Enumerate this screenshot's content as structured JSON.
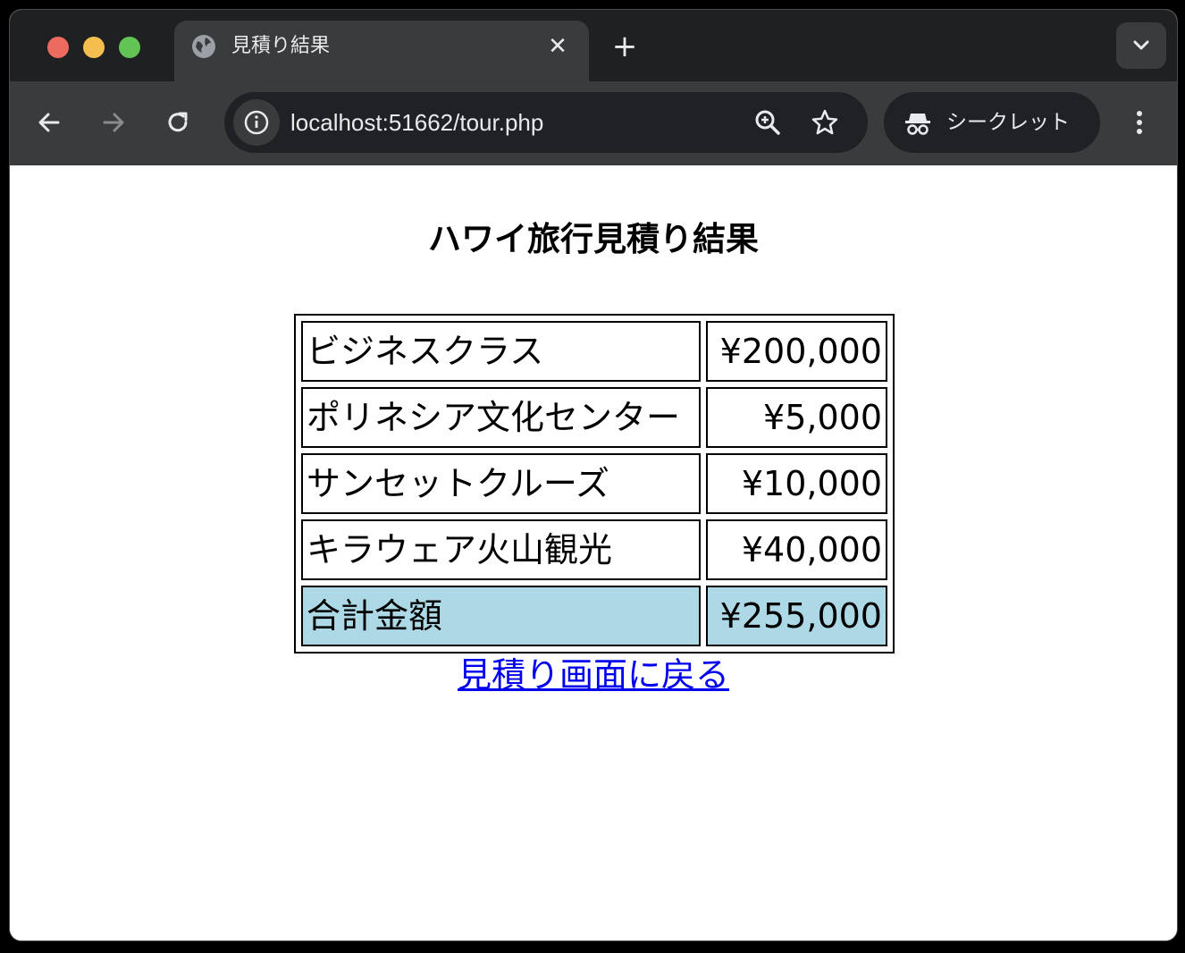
{
  "browser": {
    "tab": {
      "title": "見積り結果",
      "icon": "globe-icon"
    },
    "address_bar": {
      "url": "localhost:51662/tour.php"
    },
    "incognito_label": "シークレット"
  },
  "page": {
    "heading": "ハワイ旅行見積り結果",
    "rows": [
      {
        "item": "ビジネスクラス",
        "price": "¥200,000"
      },
      {
        "item": "ポリネシア文化センター",
        "price": "¥5,000"
      },
      {
        "item": "サンセットクルーズ",
        "price": "¥10,000"
      },
      {
        "item": "キラウェア火山観光",
        "price": "¥40,000"
      }
    ],
    "total": {
      "label": "合計金額",
      "price": "¥255,000"
    },
    "back_link": "見積り画面に戻る",
    "total_row_color": "#add8e6",
    "link_color": "#0000ee"
  }
}
